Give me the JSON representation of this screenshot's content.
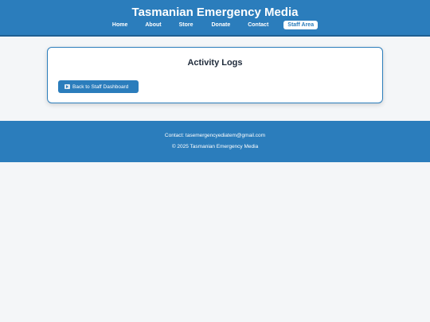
{
  "header": {
    "title": "Tasmanian Emergency Media",
    "nav": [
      {
        "label": "Home"
      },
      {
        "label": "About"
      },
      {
        "label": "Store"
      },
      {
        "label": "Donate"
      },
      {
        "label": "Contact"
      },
      {
        "label": "Staff Area"
      }
    ]
  },
  "main": {
    "title": "Activity Logs",
    "back_button_label": "Back to Staff Dashboard",
    "back_button_icon": "back-arrow-icon"
  },
  "footer": {
    "contact": "Contact: tasemergencyediatem@gmail.com",
    "copyright": "© 2025 Tasmanian Emergency Media"
  },
  "colors": {
    "brand": "#2b7dbc",
    "background": "#f4f6f8",
    "title_text": "#1e2a3a"
  }
}
